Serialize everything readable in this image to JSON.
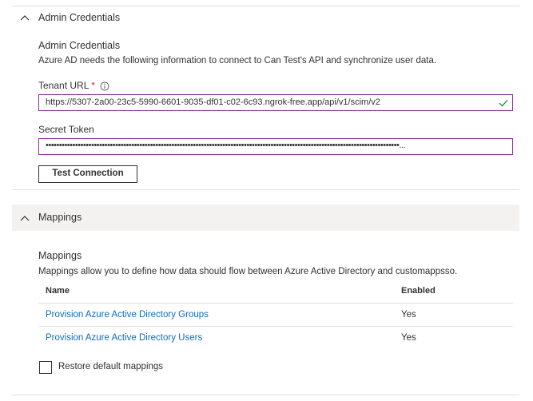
{
  "admin": {
    "section_title": "Admin Credentials",
    "heading": "Admin Credentials",
    "description": "Azure AD needs the following information to connect to Can Test's API and synchronize user data.",
    "tenant_url_label": "Tenant URL",
    "required_mark": "*",
    "info_icon": "info-icon",
    "tenant_url_value": "https://5307-2a00-23c5-5990-6601-9035-df01-c02-6c93.ngrok-free.app/api/v1/scim/v2",
    "secret_token_label": "Secret Token",
    "secret_token_value": "••••••••••••••••••••••••••••••••••••••••••••••••••••••••••••••••••••••••••••••••••••••••••••••••••••••••••••••••••••••••••••••••••••...",
    "test_connection_label": "Test Connection"
  },
  "mappings": {
    "section_title": "Mappings",
    "heading": "Mappings",
    "description": "Mappings allow you to define how data should flow between Azure Active Directory and customappsso.",
    "columns": [
      "Name",
      "Enabled"
    ],
    "rows": [
      {
        "name": "Provision Azure Active Directory Groups",
        "enabled": "Yes"
      },
      {
        "name": "Provision Azure Active Directory Users",
        "enabled": "Yes"
      }
    ],
    "restore_label": "Restore default mappings"
  },
  "colors": {
    "input_border": "#8a2c9a",
    "link": "#0f6cbd",
    "required": "#c4314b",
    "success": "#107c10",
    "band": "#f3f2f1"
  }
}
